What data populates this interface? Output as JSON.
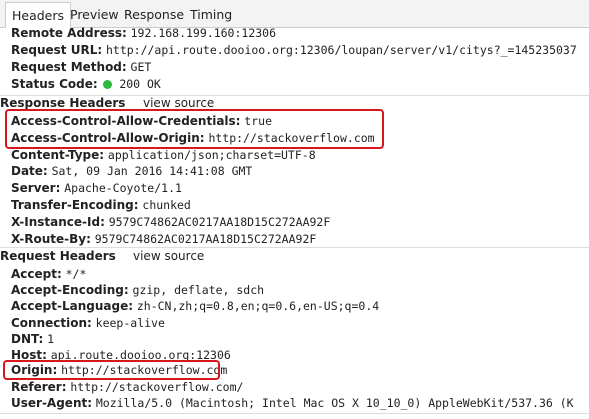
{
  "tabs": [
    {
      "label": "Headers",
      "active": true
    },
    {
      "label": "Preview",
      "active": false
    },
    {
      "label": "Response",
      "active": false
    },
    {
      "label": "Timing",
      "active": false
    }
  ],
  "general": [
    {
      "key": "Remote Address:",
      "value": "192.168.199.160:12306"
    },
    {
      "key": "Request URL:",
      "value": "http://api.route.dooioo.org:12306/loupan/server/v1/citys?_=145235037"
    },
    {
      "key": "Request Method:",
      "value": "GET"
    },
    {
      "key": "Status Code:",
      "value": "200 OK",
      "status_color": "#2bba3a"
    }
  ],
  "response_headers": {
    "title": "Response Headers",
    "view_source": "view source",
    "items": [
      {
        "key": "Access-Control-Allow-Credentials:",
        "value": "true"
      },
      {
        "key": "Access-Control-Allow-Origin:",
        "value": "http://stackoverflow.com"
      },
      {
        "key": "Content-Type:",
        "value": "application/json;charset=UTF-8"
      },
      {
        "key": "Date:",
        "value": "Sat, 09 Jan 2016 14:41:08 GMT"
      },
      {
        "key": "Server:",
        "value": "Apache-Coyote/1.1"
      },
      {
        "key": "Transfer-Encoding:",
        "value": "chunked"
      },
      {
        "key": "X-Instance-Id:",
        "value": "9579C74862AC0217AA18D15C272AA92F"
      },
      {
        "key": "X-Route-By:",
        "value": "9579C74862AC0217AA18D15C272AA92F"
      }
    ]
  },
  "request_headers": {
    "title": "Request Headers",
    "view_source": "view source",
    "items": [
      {
        "key": "Accept:",
        "value": "*/*"
      },
      {
        "key": "Accept-Encoding:",
        "value": "gzip, deflate, sdch"
      },
      {
        "key": "Accept-Language:",
        "value": "zh-CN,zh;q=0.8,en;q=0.6,en-US;q=0.4"
      },
      {
        "key": "Connection:",
        "value": "keep-alive"
      },
      {
        "key": "DNT:",
        "value": "1"
      },
      {
        "key": "Host:",
        "value": "api.route.dooioo.org:12306"
      },
      {
        "key": "Origin:",
        "value": "http://stackoverflow.com"
      },
      {
        "key": "Referer:",
        "value": "http://stackoverflow.com/"
      },
      {
        "key": "User-Agent:",
        "value": "Mozilla/5.0 (Macintosh; Intel Mac OS X 10_10_0) AppleWebKit/537.36 (K"
      }
    ]
  },
  "highlight_color": "#d8161d"
}
